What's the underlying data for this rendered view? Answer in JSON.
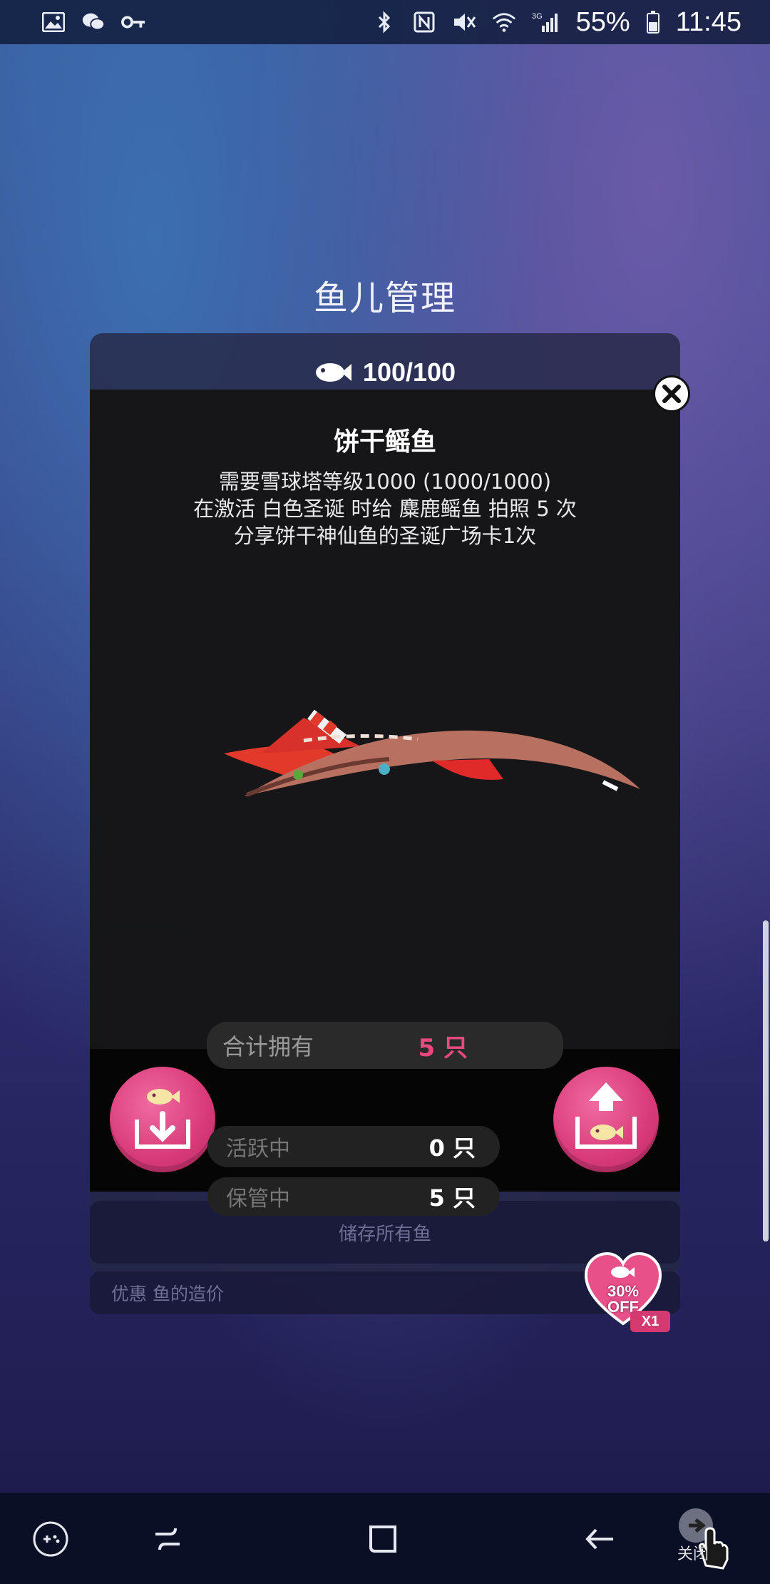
{
  "status_bar": {
    "left_icons": [
      "image-icon",
      "wechat-icon",
      "key-icon"
    ],
    "right_icons": [
      "bluetooth-icon",
      "nfc-icon",
      "mute-icon",
      "wifi-icon",
      "signal-icon",
      "battery-icon"
    ],
    "network": "3G",
    "battery": "55%",
    "time": "11:45"
  },
  "page": {
    "title": "鱼儿管理"
  },
  "fish_counter": {
    "value": "100/100"
  },
  "dialog": {
    "fish_name": "饼干鳐鱼",
    "requirements": [
      "需要雪球塔等级1000 (1000/1000)",
      "在激活 白色圣诞 时给 麋鹿鳐鱼 拍照 5 次",
      "分享饼干神仙鱼的圣诞广场卡1次"
    ]
  },
  "totals": {
    "owned_label": "合计拥有",
    "owned_value": "5 只",
    "active_label": "活跃中",
    "active_value": "0 只",
    "stored_label": "保管中",
    "stored_value": "5 只"
  },
  "buttons": {
    "store_all": "储存所有鱼"
  },
  "discount": {
    "label": "优惠 鱼的造价",
    "percent": "30%",
    "off": "OFF",
    "count": "X1"
  },
  "nav": {
    "close_label": "关闭"
  },
  "colors": {
    "accent": "#e0457f",
    "owned_value": "#e84a7f"
  }
}
